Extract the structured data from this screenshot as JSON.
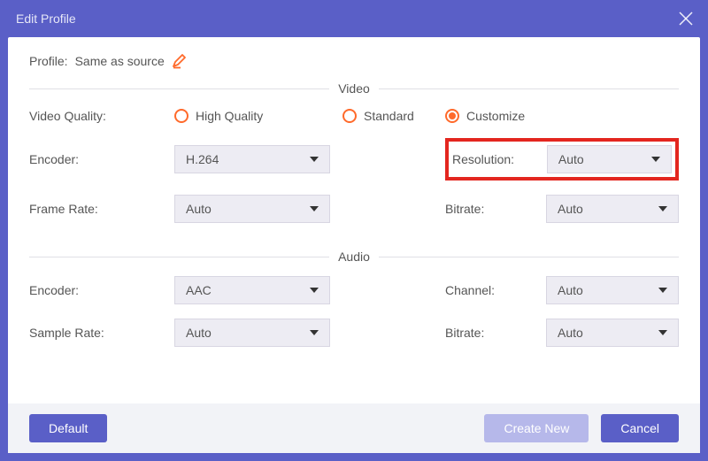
{
  "titlebar": {
    "title": "Edit Profile"
  },
  "profile": {
    "label": "Profile:",
    "value": "Same as source"
  },
  "sections": {
    "video": "Video",
    "audio": "Audio"
  },
  "video": {
    "quality_label": "Video Quality:",
    "quality_high": "High Quality",
    "quality_standard": "Standard",
    "quality_customize": "Customize",
    "quality_selected": "Customize",
    "encoder_label": "Encoder:",
    "encoder_value": "H.264",
    "resolution_label": "Resolution:",
    "resolution_value": "Auto",
    "framerate_label": "Frame Rate:",
    "framerate_value": "Auto",
    "bitrate_label": "Bitrate:",
    "bitrate_value": "Auto"
  },
  "audio": {
    "encoder_label": "Encoder:",
    "encoder_value": "AAC",
    "channel_label": "Channel:",
    "channel_value": "Auto",
    "samplerate_label": "Sample Rate:",
    "samplerate_value": "Auto",
    "bitrate_label": "Bitrate:",
    "bitrate_value": "Auto"
  },
  "footer": {
    "default": "Default",
    "create_new": "Create New",
    "cancel": "Cancel"
  },
  "colors": {
    "accent": "#5a5fc7",
    "radio": "#ff6a2b",
    "highlight": "#e3261f"
  }
}
